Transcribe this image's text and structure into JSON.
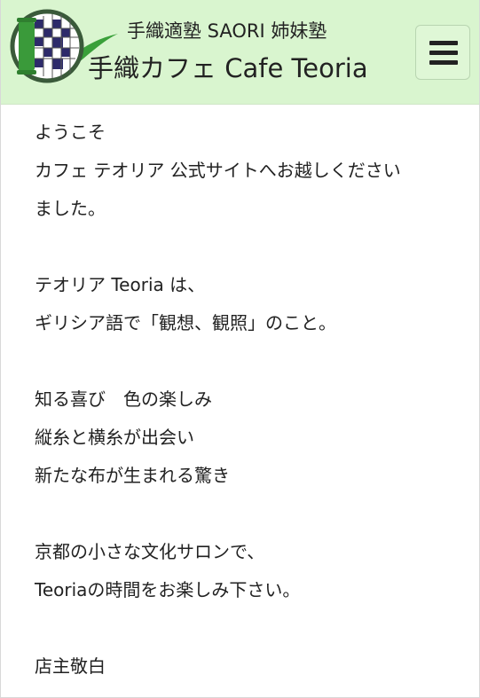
{
  "header": {
    "sub_title": "手織適塾 SAORI 姉妹塾",
    "main_title": "手織カフェ Cafe Teoria",
    "menu_icon": "hamburger-menu-icon",
    "background_color": "#d9f5cf",
    "logo_colors": {
      "spool": "#3a9a3a",
      "dark_square": "#2d2a6a",
      "ring": "#3a5a3a",
      "leaf": "#3aa03a"
    }
  },
  "content": {
    "lines": [
      "ようこそ",
      "カフェ テオリア 公式サイトへお越しください",
      "ました。",
      "",
      "テオリア Teoria は、",
      "ギリシア語で「観想、観照」のこと。",
      "",
      "知る喜び　色の楽しみ",
      "縦糸と横糸が出会い",
      "新たな布が生まれる驚き",
      "",
      "京都の小さな文化サロンで、",
      "Teoriaの時間をお楽しみ下さい。",
      "",
      "店主敬白"
    ]
  }
}
